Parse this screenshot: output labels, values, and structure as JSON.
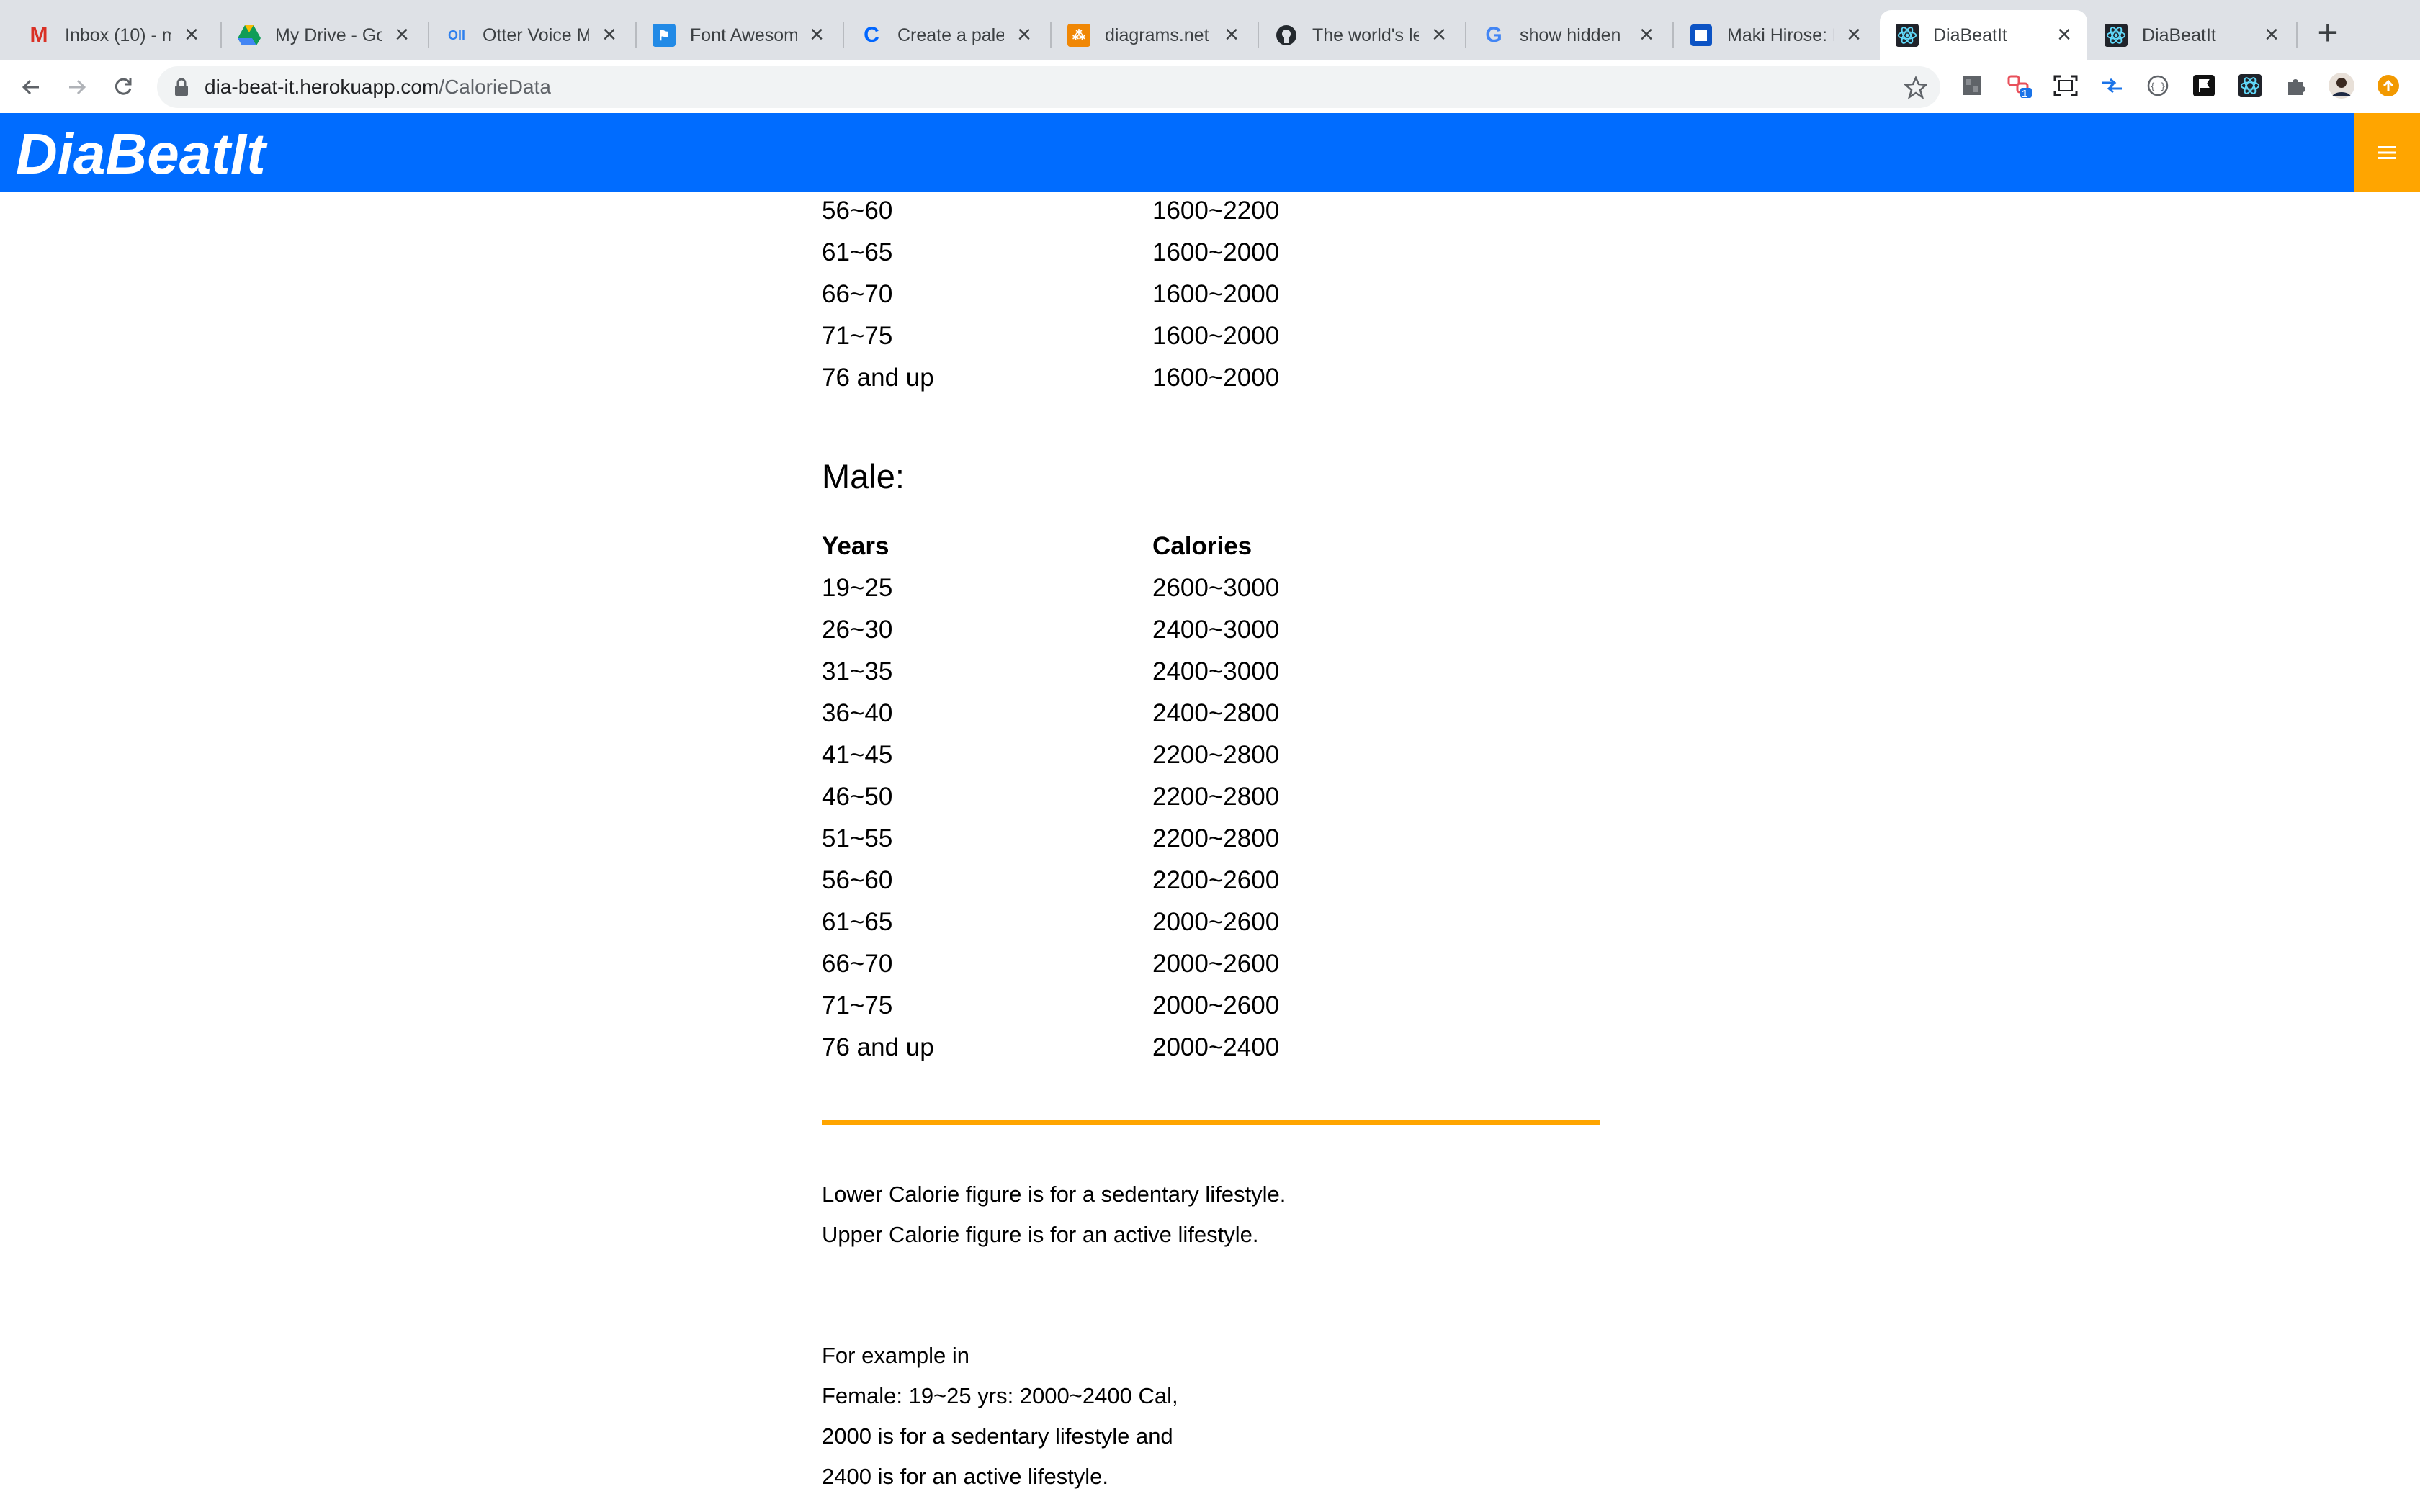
{
  "browser": {
    "tabs": [
      {
        "title": "Inbox (10) - m",
        "icon": "gmail-icon"
      },
      {
        "title": "My Drive - Go",
        "icon": "google-drive-icon"
      },
      {
        "title": "Otter Voice M",
        "icon": "otter-icon"
      },
      {
        "title": "Font Awesome",
        "icon": "font-awesome-icon"
      },
      {
        "title": "Create a palet",
        "icon": "coolors-icon"
      },
      {
        "title": "diagrams.net",
        "icon": "diagrams-icon"
      },
      {
        "title": "The world's le",
        "icon": "github-icon"
      },
      {
        "title": "show hidden f",
        "icon": "google-icon"
      },
      {
        "title": "Maki Hirose: L",
        "icon": "trello-icon"
      },
      {
        "title": "DiaBeatIt",
        "icon": "react-icon"
      },
      {
        "title": "DiaBeatIt",
        "icon": "react-icon"
      }
    ],
    "active_tab_index": 9,
    "url_domain": "dia-beat-it.herokuapp.com",
    "url_path": "/CalorieData",
    "extension_badge": "1"
  },
  "app": {
    "brand": "DiaBeatIt",
    "menu_icon": "hamburger-menu-icon"
  },
  "female_tail": [
    {
      "years": "56~60",
      "calories": "1600~2200"
    },
    {
      "years": "61~65",
      "calories": "1600~2000"
    },
    {
      "years": "66~70",
      "calories": "1600~2000"
    },
    {
      "years": "71~75",
      "calories": "1600~2000"
    },
    {
      "years": "76 and up",
      "calories": "1600~2000"
    }
  ],
  "male": {
    "title": "Male:",
    "header": {
      "years": "Years",
      "calories": "Calories"
    },
    "rows": [
      {
        "years": "19~25",
        "calories": "2600~3000"
      },
      {
        "years": "26~30",
        "calories": "2400~3000"
      },
      {
        "years": "31~35",
        "calories": "2400~3000"
      },
      {
        "years": "36~40",
        "calories": "2400~2800"
      },
      {
        "years": "41~45",
        "calories": "2200~2800"
      },
      {
        "years": "46~50",
        "calories": "2200~2800"
      },
      {
        "years": "51~55",
        "calories": "2200~2800"
      },
      {
        "years": "56~60",
        "calories": "2200~2600"
      },
      {
        "years": "61~65",
        "calories": "2000~2600"
      },
      {
        "years": "66~70",
        "calories": "2000~2600"
      },
      {
        "years": "71~75",
        "calories": "2000~2600"
      },
      {
        "years": "76 and up",
        "calories": "2000~2400"
      }
    ]
  },
  "notes": {
    "lower": "Lower Calorie figure is for a sedentary lifestyle.",
    "upper": "Upper Calorie figure is for an active lifestyle.",
    "example_lines": [
      "For example in",
      "Female: 19~25 yrs: 2000~2400 Cal,",
      "2000 is for a sedentary lifestyle and",
      "2400 is for an active lifestyle."
    ]
  },
  "colors": {
    "brand_blue": "#006cff",
    "accent_orange": "#ffa500"
  }
}
